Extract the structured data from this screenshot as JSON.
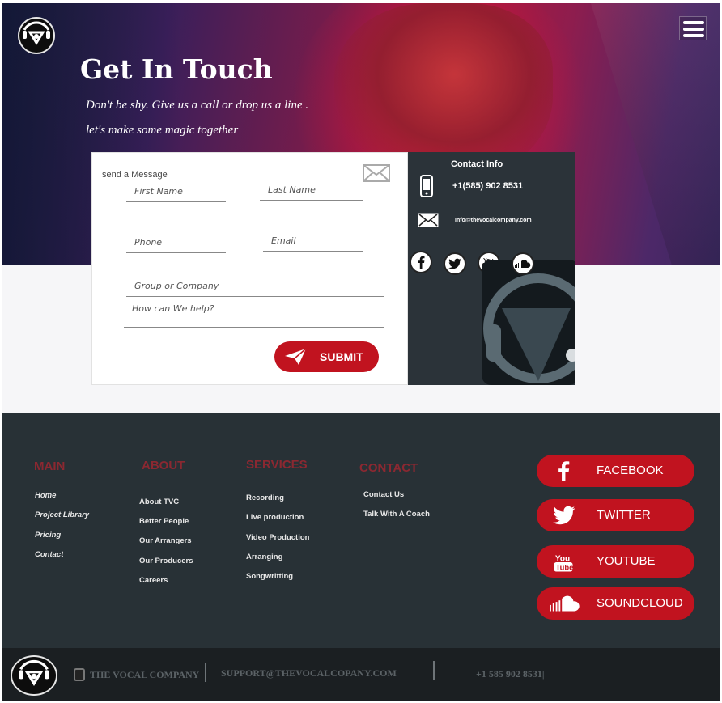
{
  "hero": {
    "title": "Get In Touch",
    "subtitle_line1": "Don't be shy. Give us a call or drop us a line .",
    "subtitle_line2": "let's make some magic together"
  },
  "form": {
    "heading": "send a Message",
    "first_name_placeholder": "First Name",
    "last_name_placeholder": "Last Name",
    "phone_placeholder": "Phone",
    "email_placeholder": "Email",
    "company_placeholder": "Group or Company",
    "message_placeholder": "How can We help?",
    "submit_label": "SUBMIT"
  },
  "contact_info": {
    "title": "Contact Info",
    "phone": "+1(585) 902 8531",
    "email": "Info@thevocalcompany.com",
    "socials": [
      "facebook-icon",
      "twitter-icon",
      "youtube-icon",
      "soundcloud-icon"
    ]
  },
  "footer": {
    "columns": [
      {
        "title": "MAIN",
        "links": [
          "Home",
          "Project Library",
          "Pricing",
          "Contact"
        ]
      },
      {
        "title": "ABOUT",
        "links": [
          "About TVC",
          "Better People",
          "Our Arrangers",
          "Our Producers",
          "Careers"
        ]
      },
      {
        "title": "SERVICES",
        "links": [
          "Recording",
          "Live production",
          "Video Production",
          "Arranging",
          "Songwritting"
        ]
      },
      {
        "title": "CONTACT",
        "links": [
          "Contact Us",
          "Talk With A Coach"
        ]
      }
    ],
    "social_buttons": [
      {
        "label": "FACEBOOK",
        "icon": "facebook-icon"
      },
      {
        "label": "TWITTER",
        "icon": "twitter-icon"
      },
      {
        "label": "YOUTUBE",
        "icon": "youtube-icon"
      },
      {
        "label": "SOUNDCLOUD",
        "icon": "soundcloud-icon"
      }
    ]
  },
  "bottom_bar": {
    "company": "THE VOCAL COMPANY",
    "support_email": "SUPPORT@THEVOCALCOPANY.COM",
    "phone": "+1 585 902  8531|"
  },
  "colors": {
    "accent": "#c1131f",
    "footer_bg": "#283136",
    "info_bg": "#2b3339",
    "footer_heading": "#8b2831"
  }
}
